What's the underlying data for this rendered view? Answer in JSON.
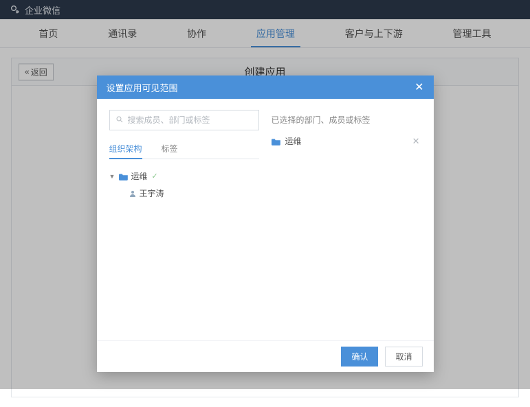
{
  "app_name": "企业微信",
  "nav": {
    "tabs": [
      "首页",
      "通讯录",
      "协作",
      "应用管理",
      "客户与上下游",
      "管理工具"
    ],
    "active_index": 3
  },
  "page": {
    "back_label": "返回",
    "title": "创建应用"
  },
  "dialog": {
    "title": "设置应用可见范围",
    "search_placeholder": "搜索成员、部门或标签",
    "subtabs": {
      "items": [
        "组织架构",
        "标签"
      ],
      "active_index": 0
    },
    "tree": {
      "root": {
        "name": "运维",
        "expanded": true,
        "checked": true
      },
      "children": [
        {
          "name": "王宇涛",
          "type": "person"
        }
      ]
    },
    "right_title": "已选择的部门、成员或标签",
    "selected": [
      {
        "name": "运维",
        "type": "folder"
      }
    ],
    "confirm_label": "确认",
    "cancel_label": "取消"
  }
}
